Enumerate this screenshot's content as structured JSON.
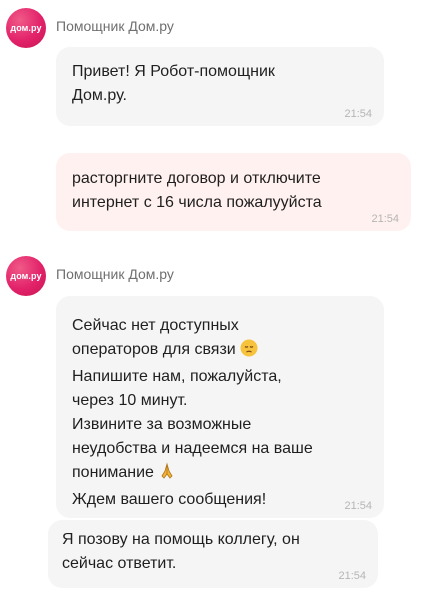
{
  "messages": [
    {
      "type": "bot",
      "avatar_text": "дом.ру",
      "sender": "Помощник Дом.ру",
      "lines": [
        "Привет! Я Робот-помощник",
        "Дом.ру."
      ],
      "time": "21:54"
    },
    {
      "type": "user",
      "lines": [
        "расторгните договор и отключите",
        "интернет с 16 числа пожалууйста"
      ],
      "time": "21:54"
    },
    {
      "type": "bot",
      "avatar_text": "дом.ру",
      "sender": "Помощник Дом.ру",
      "lines": [
        "Сейчас нет доступных",
        "операторов для связи",
        "Напишите нам, пожалуйста,",
        "через 10 минут.",
        "Извините за возможные",
        "неудобства и надеемся на ваше",
        "понимание",
        "Ждем вашего сообщения!"
      ],
      "emojis": [
        "pensive-face-icon",
        "folded-hands-icon"
      ],
      "time": "21:54"
    },
    {
      "type": "bot",
      "lines": [
        "Я позову на помощь коллегу, он",
        "сейчас ответит."
      ],
      "time": "21:54"
    }
  ],
  "colors": {
    "brand": "#e2226a",
    "bot_bubble": "#f5f5f5",
    "user_bubble": "#fff1ef",
    "timestamp": "#b5b5b5",
    "sender": "#6f6f6f"
  }
}
